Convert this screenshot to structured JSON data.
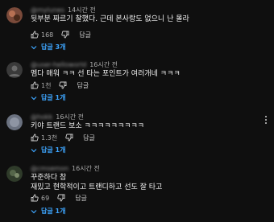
{
  "comments": [
    {
      "author": "@mylunes",
      "time": "14시간 전",
      "text": [
        "뒷부분 짜르기 찰했다. 근데 본사랑도 없으니 난 몰라"
      ],
      "likes": "168",
      "reply_label": "답글",
      "replies_label": "답글 3개",
      "avatar_color": "#7a4a3a"
    },
    {
      "author": "@user-helloworld",
      "time": "16시간 전",
      "text": [
        "멤다 매워 ㅋㅋ 선 타는 포인트가 여러개네 ㅋㅋㅋ"
      ],
      "likes": "1천",
      "reply_label": "답글",
      "replies_label": "답글 1개",
      "avatar_color": "#3a3a3a"
    },
    {
      "author": "@hokk",
      "time": "16시간 전",
      "text": [
        "키야 트랜드 보소 ㅋㅋㅋㅋㅋㅋㅋㅋㅋ"
      ],
      "likes": "1.3천",
      "reply_label": "답글",
      "replies_label": "답글 1개",
      "avatar_color": "#6b7280"
    },
    {
      "author": "@cmsemon",
      "time": "16시간 전",
      "text": [
        "꾸준하다 참",
        "재밌고 현학적이고 트랜디하고 선도 잘 타고"
      ],
      "likes": "69",
      "reply_label": "답글",
      "replies_label": "답글 1개",
      "avatar_color": "#2f3b2a"
    }
  ]
}
